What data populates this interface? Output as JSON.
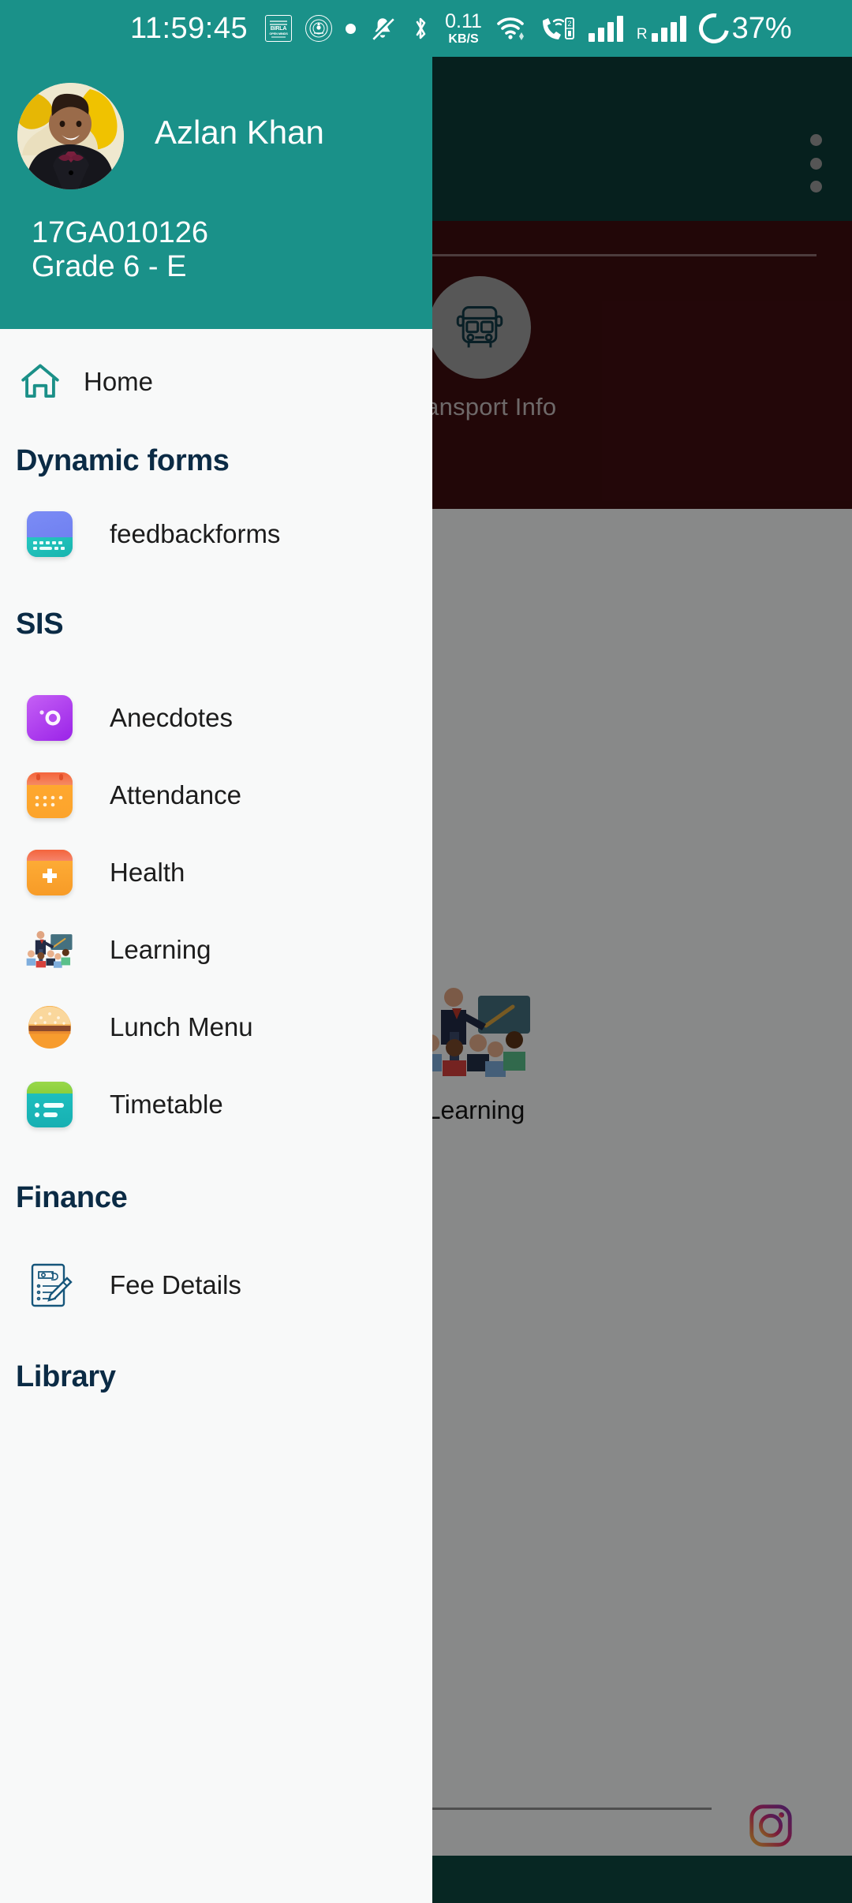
{
  "status_bar": {
    "clock": "11:59:45",
    "network_speed_value": "0.11",
    "network_speed_unit": "KB/S",
    "battery_percent": "37%",
    "sim2_label": "2",
    "roaming_label": "R",
    "icons": [
      "birla-open-minds-logo-icon",
      "school-crest-icon",
      "dot-icon",
      "mute-bell-icon",
      "bluetooth-icon",
      "network-speed-icon",
      "wifi-icon",
      "vowifi-call-icon",
      "sim1-signal-icon",
      "sim2-roaming-signal-icon",
      "battery-ring-icon"
    ],
    "brand_logo_text": "BIRLA OPEN MINDS"
  },
  "drawer": {
    "profile": {
      "name": "Azlan Khan",
      "student_id": "17GA010126",
      "grade": "Grade 6 - E"
    },
    "home": {
      "label": "Home",
      "icon": "home-icon"
    },
    "sections": [
      {
        "title": "Dynamic forms",
        "items": [
          {
            "label": "feedbackforms",
            "icon": "feedback-forms-icon"
          }
        ]
      },
      {
        "title": "SIS",
        "items": [
          {
            "label": "Anecdotes",
            "icon": "anecdotes-camera-icon"
          },
          {
            "label": "Attendance",
            "icon": "attendance-calendar-icon"
          },
          {
            "label": "Health",
            "icon": "health-plus-icon"
          },
          {
            "label": "Learning",
            "icon": "learning-classroom-icon"
          },
          {
            "label": "Lunch Menu",
            "icon": "lunch-burger-icon"
          },
          {
            "label": "Timetable",
            "icon": "timetable-icon"
          }
        ]
      },
      {
        "title": "Finance",
        "items": [
          {
            "label": "Fee Details",
            "icon": "fee-details-icon"
          }
        ]
      },
      {
        "title": "Library",
        "items": []
      }
    ]
  },
  "background_app": {
    "overflow_menu": "overflow-menu-icon",
    "transport_tile": {
      "label": "Transport Info",
      "icon": "bus-icon"
    },
    "learning_tile": {
      "label": "Learning",
      "icon": "learning-classroom-icon"
    },
    "instagram": {
      "icon": "instagram-icon"
    }
  },
  "colors": {
    "teal": "#1A9189",
    "dark_teal": "#0B3B37",
    "dark_red": "#3F0D10",
    "drawer_bg": "#F8F9F9",
    "section_title": "#0B2B45",
    "bottom_bar": "#0D4741"
  }
}
